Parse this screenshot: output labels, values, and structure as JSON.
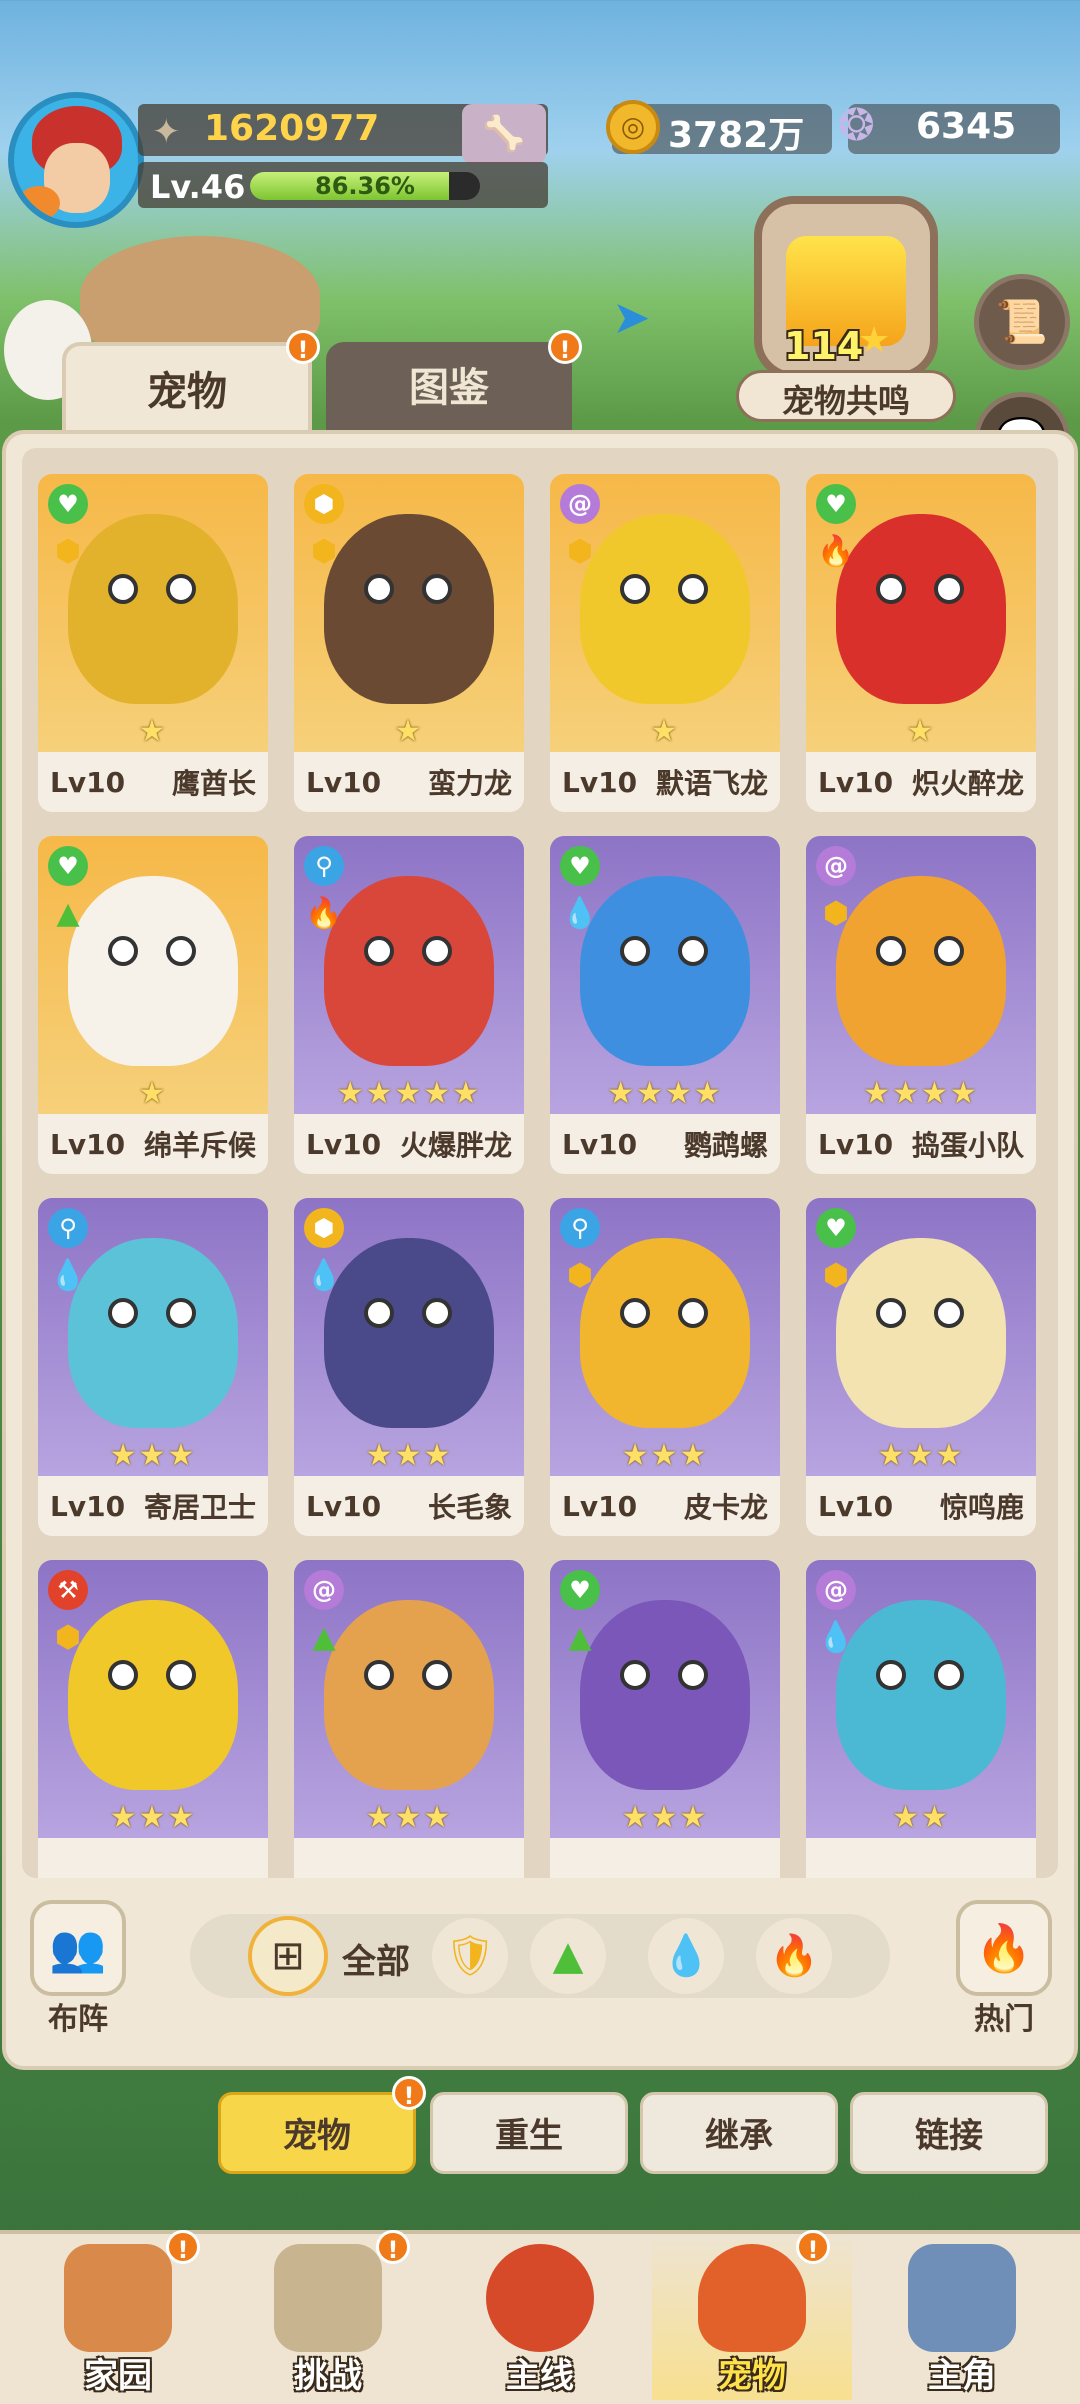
{
  "player": {
    "power": "1620977",
    "level": "Lv.46",
    "xp_text": "86.36%",
    "xp_fraction": 0.8636
  },
  "resources": {
    "gold": "3782万",
    "shells": "6345"
  },
  "resonance": {
    "value": "114",
    "label": "宠物共鸣"
  },
  "tabs": {
    "pets": "宠物",
    "codex": "图鉴"
  },
  "pets": [
    {
      "level": "Lv10",
      "name": "鹰酋长",
      "stars": "★",
      "theme": "orange",
      "type_icon": "heart",
      "element": "shield",
      "color": "#e3b22c"
    },
    {
      "level": "Lv10",
      "name": "蛮力龙",
      "stars": "★",
      "theme": "orange",
      "type_icon": "shield",
      "element": "shield",
      "color": "#6b4a33"
    },
    {
      "level": "Lv10",
      "name": "默语飞龙",
      "stars": "★",
      "theme": "orange",
      "type_icon": "spiral",
      "element": "shield",
      "color": "#f1c82b"
    },
    {
      "level": "Lv10",
      "name": "炽火醉龙",
      "stars": "★",
      "theme": "orange",
      "type_icon": "heart",
      "element": "fire",
      "color": "#d9302b"
    },
    {
      "level": "Lv10",
      "name": "绵羊斥候",
      "stars": "★",
      "theme": "orange",
      "type_icon": "heart",
      "element": "leaf",
      "color": "#f6f2ea"
    },
    {
      "level": "Lv10",
      "name": "火爆胖龙",
      "stars": "★★★★★",
      "theme": "purple",
      "type_icon": "key",
      "element": "fire",
      "color": "#d9473a"
    },
    {
      "level": "Lv10",
      "name": "鹦鹉螺",
      "stars": "★★★★",
      "theme": "purple",
      "type_icon": "heart",
      "element": "water",
      "color": "#3f8fe0"
    },
    {
      "level": "Lv10",
      "name": "捣蛋小队",
      "stars": "★★★★",
      "theme": "purple",
      "type_icon": "spiral",
      "element": "shield",
      "color": "#f0a330"
    },
    {
      "level": "Lv10",
      "name": "寄居卫士",
      "stars": "★★★",
      "theme": "purple",
      "type_icon": "key",
      "element": "water",
      "color": "#5cc2d8"
    },
    {
      "level": "Lv10",
      "name": "长毛象",
      "stars": "★★★",
      "theme": "purple",
      "type_icon": "shield",
      "element": "water",
      "color": "#4a4a8a"
    },
    {
      "level": "Lv10",
      "name": "皮卡龙",
      "stars": "★★★",
      "theme": "purple",
      "type_icon": "key",
      "element": "shield",
      "color": "#f2b52e"
    },
    {
      "level": "Lv10",
      "name": "惊鸣鹿",
      "stars": "★★★",
      "theme": "purple",
      "type_icon": "heart",
      "element": "shield",
      "color": "#f3e3b0"
    },
    {
      "level": "",
      "name": "",
      "stars": "★★★",
      "theme": "purple",
      "type_icon": "axe",
      "element": "shield",
      "color": "#f0c82a"
    },
    {
      "level": "",
      "name": "",
      "stars": "★★★",
      "theme": "purple",
      "type_icon": "spiral",
      "element": "leaf",
      "color": "#e4a24f"
    },
    {
      "level": "",
      "name": "",
      "stars": "★★★",
      "theme": "purple",
      "type_icon": "heart",
      "element": "leaf",
      "color": "#7a57b8"
    },
    {
      "level": "",
      "name": "",
      "stars": "★★",
      "theme": "purple",
      "type_icon": "spiral",
      "element": "water",
      "color": "#4bb9d3"
    }
  ],
  "filters": {
    "formation": "布阵",
    "all": "全部",
    "hot": "热门"
  },
  "sub_tabs": [
    "宠物",
    "重生",
    "继承",
    "链接"
  ],
  "bottom_nav": [
    "家园",
    "挑战",
    "主线",
    "宠物",
    "主角"
  ],
  "notice": "!"
}
